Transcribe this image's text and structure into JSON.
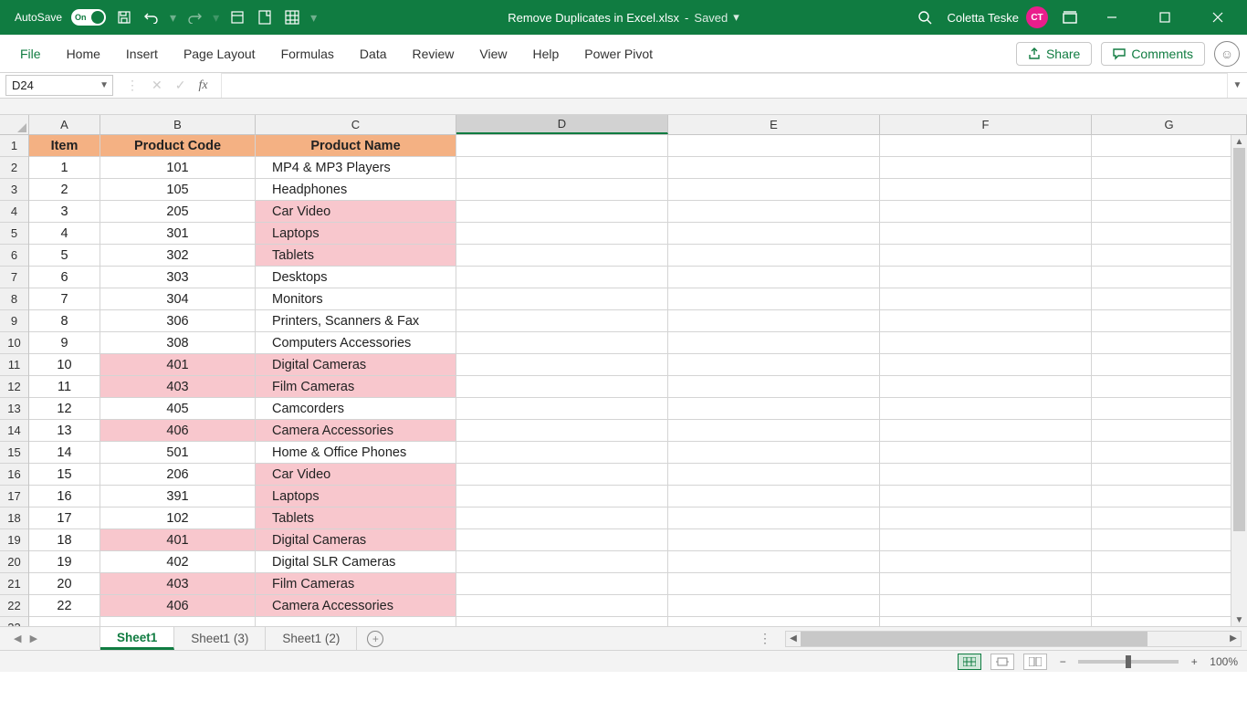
{
  "titlebar": {
    "autosave": "AutoSave",
    "toggle_state": "On",
    "filename": "Remove Duplicates in Excel.xlsx",
    "saved_label": "Saved",
    "user_name": "Coletta Teske",
    "user_initials": "CT"
  },
  "ribbon": {
    "tabs": [
      "File",
      "Home",
      "Insert",
      "Page Layout",
      "Formulas",
      "Data",
      "Review",
      "View",
      "Help",
      "Power Pivot"
    ],
    "share": "Share",
    "comments": "Comments"
  },
  "formula_bar": {
    "namebox": "D24",
    "fx": "fx",
    "formula": ""
  },
  "columns": [
    "A",
    "B",
    "C",
    "D",
    "E",
    "F",
    "G"
  ],
  "selected_column": "D",
  "selected_cell": {
    "row": 24,
    "col": "D"
  },
  "header_row": {
    "A": "Item",
    "B": "Product Code",
    "C": "Product Name"
  },
  "rows": [
    {
      "n": 2,
      "A": "1",
      "B": "101",
      "C": "MP4 & MP3 Players",
      "hB": false,
      "hC": false
    },
    {
      "n": 3,
      "A": "2",
      "B": "105",
      "C": "Headphones",
      "hB": false,
      "hC": false
    },
    {
      "n": 4,
      "A": "3",
      "B": "205",
      "C": "Car Video",
      "hB": false,
      "hC": true
    },
    {
      "n": 5,
      "A": "4",
      "B": "301",
      "C": "Laptops",
      "hB": false,
      "hC": true
    },
    {
      "n": 6,
      "A": "5",
      "B": "302",
      "C": "Tablets",
      "hB": false,
      "hC": true
    },
    {
      "n": 7,
      "A": "6",
      "B": "303",
      "C": "Desktops",
      "hB": false,
      "hC": false
    },
    {
      "n": 8,
      "A": "7",
      "B": "304",
      "C": "Monitors",
      "hB": false,
      "hC": false
    },
    {
      "n": 9,
      "A": "8",
      "B": "306",
      "C": "Printers, Scanners & Fax",
      "hB": false,
      "hC": false
    },
    {
      "n": 10,
      "A": "9",
      "B": "308",
      "C": "Computers Accessories",
      "hB": false,
      "hC": false
    },
    {
      "n": 11,
      "A": "10",
      "B": "401",
      "C": "Digital Cameras",
      "hB": true,
      "hC": true
    },
    {
      "n": 12,
      "A": "11",
      "B": "403",
      "C": "Film Cameras",
      "hB": true,
      "hC": true
    },
    {
      "n": 13,
      "A": "12",
      "B": "405",
      "C": "Camcorders",
      "hB": false,
      "hC": false
    },
    {
      "n": 14,
      "A": "13",
      "B": "406",
      "C": "Camera Accessories",
      "hB": true,
      "hC": true
    },
    {
      "n": 15,
      "A": "14",
      "B": "501",
      "C": "Home & Office Phones",
      "hB": false,
      "hC": false
    },
    {
      "n": 16,
      "A": "15",
      "B": "206",
      "C": "Car Video",
      "hB": false,
      "hC": true
    },
    {
      "n": 17,
      "A": "16",
      "B": "391",
      "C": "Laptops",
      "hB": false,
      "hC": true
    },
    {
      "n": 18,
      "A": "17",
      "B": "102",
      "C": "Tablets",
      "hB": false,
      "hC": true
    },
    {
      "n": 19,
      "A": "18",
      "B": "401",
      "C": "Digital Cameras",
      "hB": true,
      "hC": true
    },
    {
      "n": 20,
      "A": "19",
      "B": "402",
      "C": "Digital SLR Cameras",
      "hB": false,
      "hC": false
    },
    {
      "n": 21,
      "A": "20",
      "B": "403",
      "C": "Film Cameras",
      "hB": true,
      "hC": true
    },
    {
      "n": 22,
      "A": "22",
      "B": "406",
      "C": "Camera Accessories",
      "hB": true,
      "hC": true
    }
  ],
  "empty_row": {
    "n": 23
  },
  "sheet_tabs": {
    "active": "Sheet1",
    "tabs": [
      "Sheet1",
      "Sheet1 (3)",
      "Sheet1 (2)"
    ]
  },
  "statusbar": {
    "zoom": "100%"
  }
}
